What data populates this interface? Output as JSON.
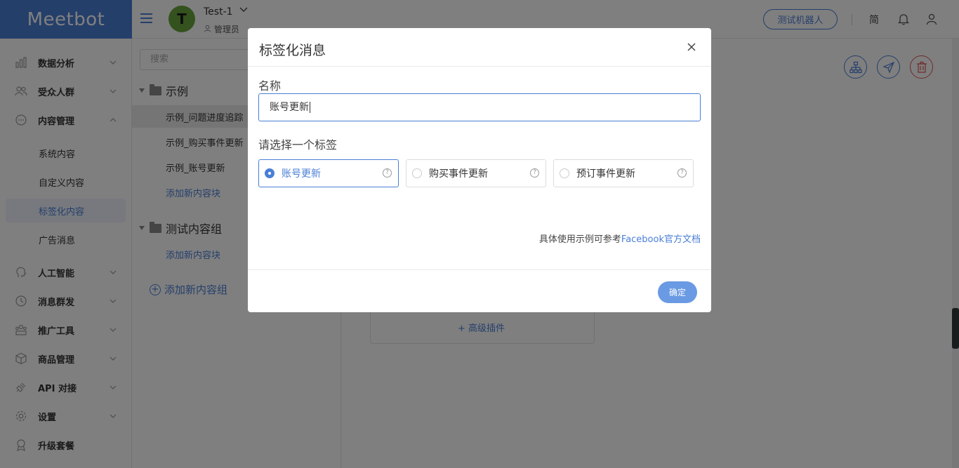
{
  "header": {
    "logo": "Meetbot",
    "account_initial": "T",
    "account_name": "Test-1",
    "account_role": "管理员",
    "test_bot_label": "测试机器人",
    "lang_label": "简"
  },
  "sidebar": {
    "items": [
      {
        "label": "数据分析"
      },
      {
        "label": "受众人群"
      },
      {
        "label": "内容管理"
      },
      {
        "label": "人工智能"
      },
      {
        "label": "消息群发"
      },
      {
        "label": "推广工具"
      },
      {
        "label": "商品管理"
      },
      {
        "label": "API 对接"
      },
      {
        "label": "设置"
      },
      {
        "label": "升级套餐"
      }
    ],
    "sub_items": [
      {
        "label": "系统内容"
      },
      {
        "label": "自定义内容"
      },
      {
        "label": "标签化内容"
      },
      {
        "label": "广告消息"
      }
    ]
  },
  "tree": {
    "search_placeholder": "搜索",
    "folders": [
      {
        "label": "示例",
        "items": [
          "示例_问题进度追踪",
          "示例_购买事件更新",
          "示例_账号更新"
        ],
        "add_label": "添加新内容块"
      },
      {
        "label": "测试内容组",
        "items": [],
        "add_label": "添加新内容块"
      }
    ],
    "add_group_label": "添加新内容组"
  },
  "main": {
    "advanced_plugin_label": "+ 高级插件"
  },
  "modal": {
    "title": "标签化消息",
    "name_label": "名称",
    "name_value": "账号更新",
    "tag_label": "请选择一个标签",
    "options": [
      {
        "label": "账号更新",
        "selected": true
      },
      {
        "label": "购买事件更新",
        "selected": false
      },
      {
        "label": "预订事件更新",
        "selected": false
      }
    ],
    "reference_text": "具体使用示例可参考",
    "reference_link": "Facebook官方文档",
    "ok_label": "确定"
  },
  "colors": {
    "primary": "#4a7fd6",
    "danger": "#e05555",
    "avatar": "#69a43b"
  }
}
